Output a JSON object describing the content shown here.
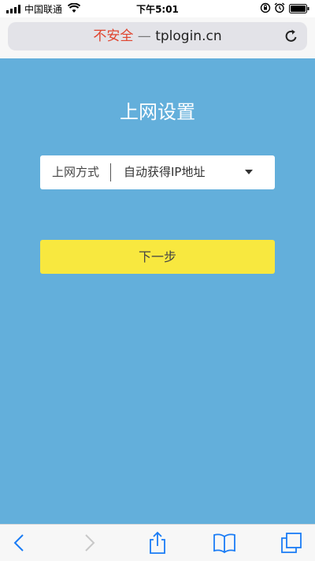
{
  "status_bar": {
    "carrier": "中国联通",
    "time": "下午5:01"
  },
  "address_bar": {
    "insecure_label": "不安全",
    "separator": " — ",
    "domain": "tplogin.cn"
  },
  "page": {
    "title": "上网设置",
    "connection_field": {
      "label": "上网方式",
      "value": "自动获得IP地址"
    },
    "next_button": "下一步"
  },
  "colors": {
    "background": "#63afdb",
    "button": "#f8e83f",
    "insecure": "#e0452f",
    "ios_blue": "#1a7cf5"
  },
  "icons": [
    "signal-icon",
    "wifi-icon",
    "rotation-lock-icon",
    "alarm-icon",
    "battery-icon",
    "reload-icon",
    "back-icon",
    "forward-icon",
    "share-icon",
    "bookmarks-icon",
    "tabs-icon",
    "dropdown-arrow-icon"
  ]
}
